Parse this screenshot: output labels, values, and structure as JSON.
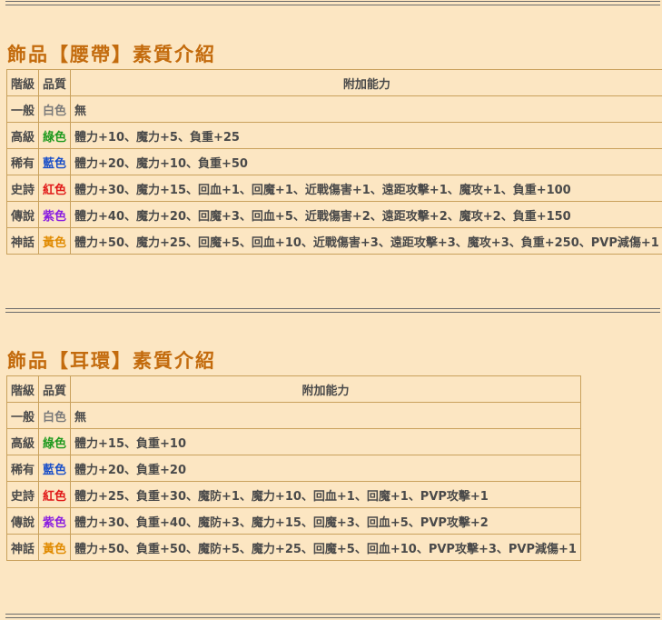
{
  "belt": {
    "title": "飾品【腰帶】素質介紹",
    "headers": {
      "tier": "階級",
      "quality": "品質",
      "ability": "附加能力"
    },
    "rows": [
      {
        "tier": "一般",
        "quality": "白色",
        "quality_color": "#7a7a7a",
        "ability": "無"
      },
      {
        "tier": "高級",
        "quality": "綠色",
        "quality_color": "#1f9a1f",
        "ability": "體力+10、魔力+5、負重+25"
      },
      {
        "tier": "稀有",
        "quality": "藍色",
        "quality_color": "#1a4fc8",
        "ability": "體力+20、魔力+10、負重+50"
      },
      {
        "tier": "史詩",
        "quality": "紅色",
        "quality_color": "#e01818",
        "ability": "體力+30、魔力+15、回血+1、回魔+1、近戰傷害+1、遠距攻擊+1、魔攻+1、負重+100"
      },
      {
        "tier": "傳說",
        "quality": "紫色",
        "quality_color": "#8a1ee0",
        "ability": "體力+40、魔力+20、回魔+3、回血+5、近戰傷害+2、遠距攻擊+2、魔攻+2、負重+150"
      },
      {
        "tier": "神話",
        "quality": "黃色",
        "quality_color": "#e08a00",
        "ability": "體力+50、魔力+25、回魔+5、回血+10、近戰傷害+3、遠距攻擊+3、魔攻+3、負重+250、PVP減傷+1"
      }
    ]
  },
  "earring": {
    "title": "飾品【耳環】素質介紹",
    "headers": {
      "tier": "階級",
      "quality": "品質",
      "ability": "附加能力"
    },
    "rows": [
      {
        "tier": "一般",
        "quality": "白色",
        "quality_color": "#7a7a7a",
        "ability": "無"
      },
      {
        "tier": "高級",
        "quality": "綠色",
        "quality_color": "#1f9a1f",
        "ability": "體力+15、負重+10"
      },
      {
        "tier": "稀有",
        "quality": "藍色",
        "quality_color": "#1a4fc8",
        "ability": "體力+20、負重+20"
      },
      {
        "tier": "史詩",
        "quality": "紅色",
        "quality_color": "#e01818",
        "ability": "體力+25、負重+30、魔防+1、魔力+10、回血+1、回魔+1、PVP攻擊+1"
      },
      {
        "tier": "傳說",
        "quality": "紫色",
        "quality_color": "#8a1ee0",
        "ability": "體力+30、負重+40、魔防+3、魔力+15、回魔+3、回血+5、PVP攻擊+2"
      },
      {
        "tier": "神話",
        "quality": "黃色",
        "quality_color": "#e08a00",
        "ability": "體力+50、負重+50、魔防+5、魔力+25、回魔+5、回血+10、PVP攻擊+3、PVP減傷+1"
      }
    ]
  }
}
